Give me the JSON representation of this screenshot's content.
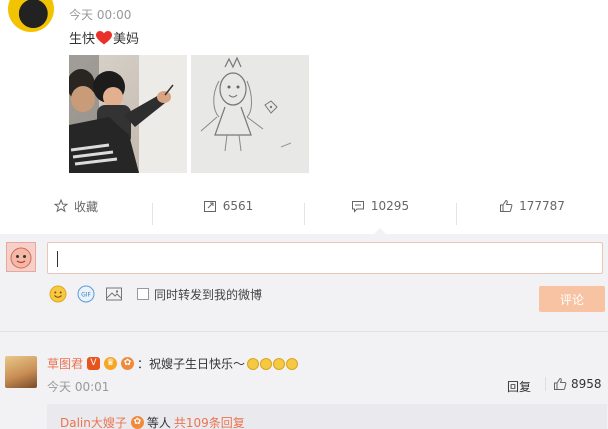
{
  "post": {
    "time": "今天 00:00",
    "text_before": "生快",
    "text_after": "美妈",
    "heart_icon": "red-heart-emoji",
    "heart_color": "#e8312a"
  },
  "actions": {
    "favorite": "收藏",
    "repost": "6561",
    "comment": "10295",
    "like": "177787"
  },
  "composer": {
    "input_value": "",
    "sync_label": "同时转发到我的微博",
    "submit_label": "评论",
    "submit_color": "#f8c3a3"
  },
  "comment": {
    "user": "草图君",
    "text": "：祝嫂子生日快乐～",
    "time": "今天 00:01",
    "reply_label": "回复",
    "likes": "8958",
    "sub": {
      "user": "Dalin大嫂子",
      "rest": "等人",
      "count": "共109条回复"
    }
  },
  "colors": {
    "accent": "#eb7350",
    "panel_bg": "#f2f2f5"
  }
}
